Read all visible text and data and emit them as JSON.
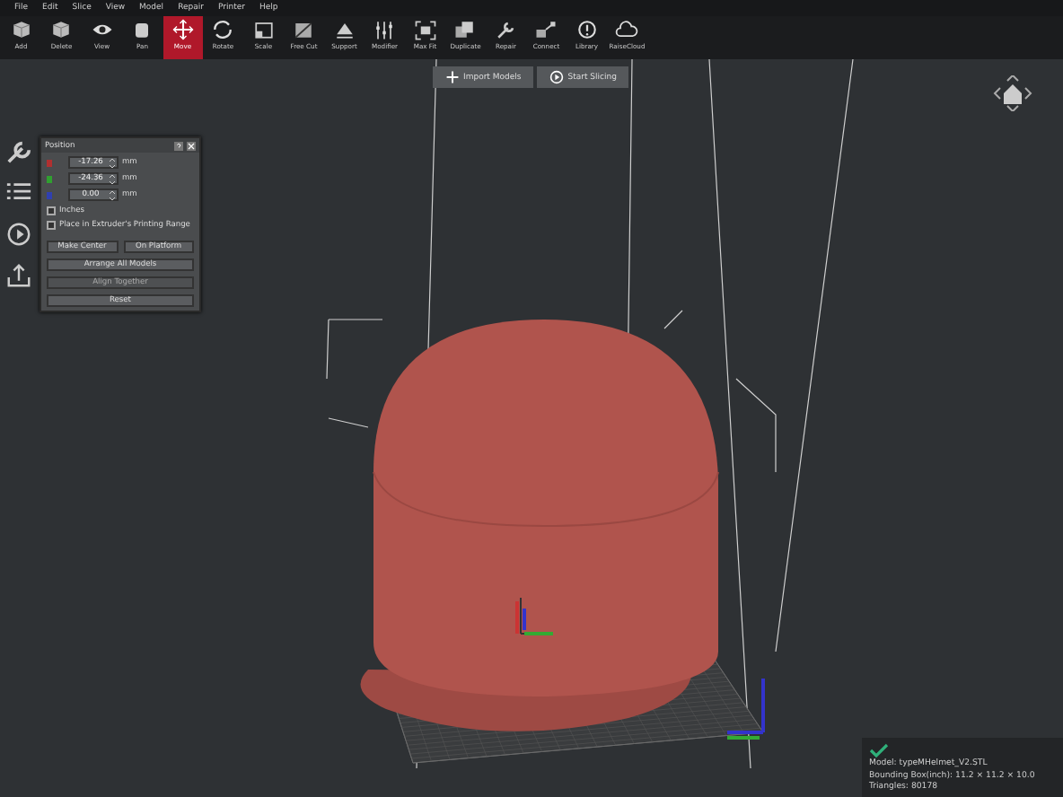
{
  "menu": [
    "File",
    "Edit",
    "Slice",
    "View",
    "Model",
    "Repair",
    "Printer",
    "Help"
  ],
  "toolbar": [
    {
      "label": "Add",
      "selected": false
    },
    {
      "label": "Delete",
      "selected": false
    },
    {
      "label": "View",
      "selected": false
    },
    {
      "label": "Pan",
      "selected": false
    },
    {
      "label": "Move",
      "selected": true
    },
    {
      "label": "Rotate",
      "selected": false
    },
    {
      "label": "Scale",
      "selected": false
    },
    {
      "label": "Free Cut",
      "selected": false
    },
    {
      "label": "Support",
      "selected": false
    },
    {
      "label": "Modifier",
      "selected": false
    },
    {
      "label": "Max Fit",
      "selected": false
    },
    {
      "label": "Duplicate",
      "selected": false
    },
    {
      "label": "Repair",
      "selected": false
    },
    {
      "label": "Connect",
      "selected": false
    },
    {
      "label": "Library",
      "selected": false
    },
    {
      "label": "RaiseCloud",
      "selected": false
    }
  ],
  "actions": [
    "Import Models",
    "Start Slicing"
  ],
  "position_panel": {
    "title": "Position",
    "fields": [
      {
        "value": "-17.26",
        "unit": "mm",
        "color": "#b03030"
      },
      {
        "value": "-24.36",
        "unit": "mm",
        "color": "#30a030"
      },
      {
        "value": "0.00",
        "unit": "mm",
        "color": "#3040b0"
      }
    ],
    "checkboxes": [
      {
        "label": "Inches",
        "checked": false
      },
      {
        "label": "Place in Extruder's Printing Range",
        "checked": false
      }
    ],
    "buttons": [
      {
        "label": "Make Center",
        "disabled": false
      },
      {
        "label": "On Platform",
        "disabled": false
      },
      {
        "label": "Arrange All Models",
        "disabled": false
      },
      {
        "label": "Align Together",
        "disabled": true
      },
      {
        "label": "Reset",
        "disabled": false
      }
    ]
  },
  "model_info": {
    "lines": [
      "Model: typeMHelmet_V2.STL",
      "Bounding Box(inch): 11.2 × 11.2 × 10.0",
      "Triangles: 80178"
    ]
  }
}
